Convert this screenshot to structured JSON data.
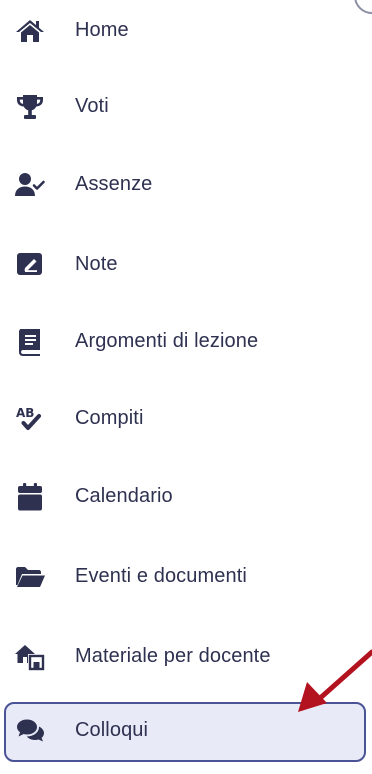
{
  "menu": {
    "items": [
      {
        "label": "Home",
        "icon": "home-icon"
      },
      {
        "label": "Voti",
        "icon": "trophy-icon"
      },
      {
        "label": "Assenze",
        "icon": "user-check-icon"
      },
      {
        "label": "Note",
        "icon": "note-pen-icon"
      },
      {
        "label": "Argomenti di lezione",
        "icon": "book-icon"
      },
      {
        "label": "Compiti",
        "icon": "spellcheck-icon"
      },
      {
        "label": "Calendario",
        "icon": "calendar-icon"
      },
      {
        "label": "Eventi e documenti",
        "icon": "folder-open-icon"
      },
      {
        "label": "Materiale per docente",
        "icon": "house-arrows-icon"
      },
      {
        "label": "Colloqui",
        "icon": "comments-icon"
      }
    ],
    "active_index": 9
  },
  "colors": {
    "icon": "#2e3150",
    "text": "#2e3150",
    "active_border": "#4a5396",
    "active_background": "#e9eaf8",
    "annotation_arrow": "#b3121f"
  }
}
